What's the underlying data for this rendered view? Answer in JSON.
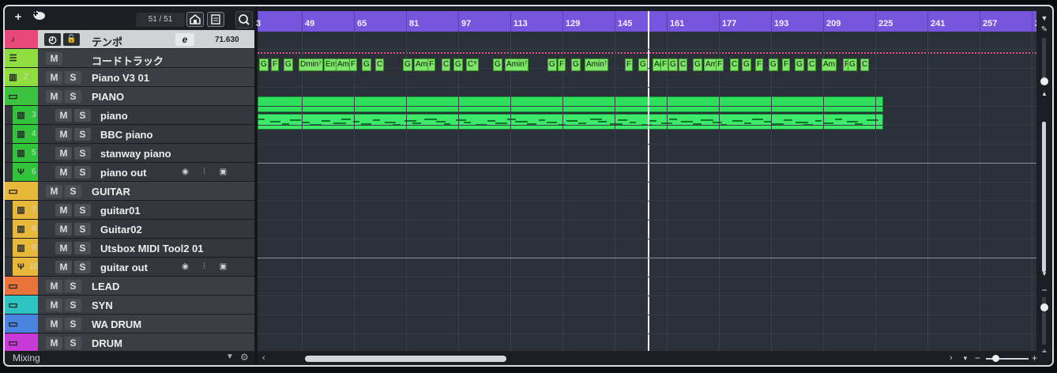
{
  "toolbar": {
    "add_label": "+",
    "counter": "51 / 51"
  },
  "tracks": [
    {
      "id": "tempo",
      "name": "テンポ",
      "color": "#e8487a",
      "bg": "#d0d3d6",
      "value": "71.630",
      "e_label": "e"
    },
    {
      "id": "chord",
      "name": "コードトラック",
      "color": "#8fdd3f",
      "mute": "M"
    },
    {
      "id": "piano-v3",
      "num": "2",
      "name": "Piano V3 01",
      "color": "#8fdd3f",
      "mute": "M",
      "solo": "S"
    },
    {
      "id": "piano-folder",
      "name": "PIANO",
      "color": "#3bc33f",
      "mute": "M",
      "solo": "S"
    },
    {
      "id": "piano",
      "num": "3",
      "name": "piano",
      "color": "#31c33b",
      "mute": "M",
      "solo": "S"
    },
    {
      "id": "bbc",
      "num": "4",
      "name": "BBC piano",
      "color": "#31c33b",
      "mute": "M",
      "solo": "S"
    },
    {
      "id": "stanway",
      "num": "5",
      "name": "stanway piano",
      "color": "#31c33b",
      "mute": "M",
      "solo": "S"
    },
    {
      "id": "pianoout",
      "num": "6",
      "name": "piano out",
      "color": "#31c33b",
      "mute": "M",
      "solo": "S"
    },
    {
      "id": "guitar-folder",
      "name": "GUITAR",
      "color": "#e8b83a",
      "mute": "M",
      "solo": "S"
    },
    {
      "id": "guitar01",
      "num": "7",
      "name": "guitar01",
      "color": "#e8b83a",
      "mute": "M",
      "solo": "S"
    },
    {
      "id": "guitar02",
      "num": "8",
      "name": "Guitar02",
      "color": "#e8b83a",
      "mute": "M",
      "solo": "S"
    },
    {
      "id": "utsbox",
      "num": "9",
      "name": "Utsbox MIDI Tool2 01",
      "color": "#e8b83a",
      "mute": "M",
      "solo": "S"
    },
    {
      "id": "guitarout",
      "num": "10",
      "name": "guitar out",
      "color": "#e8b83a",
      "mute": "M",
      "solo": "S"
    },
    {
      "id": "lead",
      "name": "LEAD",
      "color": "#e8743a",
      "mute": "M",
      "solo": "S"
    },
    {
      "id": "syn",
      "name": "SYN",
      "color": "#2ec3c3",
      "mute": "M",
      "solo": "S"
    },
    {
      "id": "wadrum",
      "name": "WA DRUM",
      "color": "#4a84e0",
      "mute": "M",
      "solo": "S"
    },
    {
      "id": "drum",
      "name": "DRUM",
      "color": "#c83ad8",
      "mute": "M",
      "solo": "S"
    }
  ],
  "bottom": {
    "mixing_label": "Mixing"
  },
  "ruler": {
    "labels": [
      "3",
      "49",
      "65",
      "81",
      "97",
      "113",
      "129",
      "145",
      "161",
      "177",
      "193",
      "209",
      "225",
      "241",
      "257",
      "2"
    ]
  },
  "chords": [
    "G",
    "F",
    "G",
    "Dmin⁷",
    "Em",
    "Am",
    "F",
    "G",
    "C",
    "G",
    "Am",
    "F",
    "C",
    "G",
    "C⁹",
    "G",
    "Amin⁷",
    "G",
    "F",
    "G",
    "Amin⁷",
    "F",
    "G",
    "Am",
    "F",
    "G",
    "C",
    "G",
    "Am",
    "F",
    "C",
    "G",
    "F",
    "G",
    "F",
    "G",
    "C",
    "Am",
    "F",
    "G",
    "C"
  ],
  "colors": {
    "ruler": "#7656dc",
    "midi": "#2ee05b",
    "chord": "#7ee56a",
    "tempo": "#d8557a"
  }
}
